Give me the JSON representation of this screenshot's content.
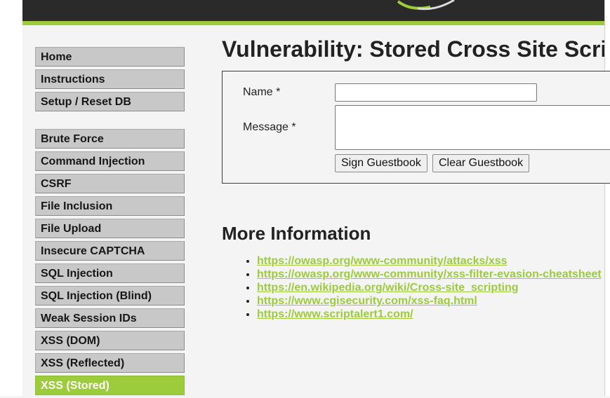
{
  "sidebar": {
    "group1": [
      {
        "label": "Home"
      },
      {
        "label": "Instructions"
      },
      {
        "label": "Setup / Reset DB"
      }
    ],
    "group2": [
      {
        "label": "Brute Force"
      },
      {
        "label": "Command Injection"
      },
      {
        "label": "CSRF"
      },
      {
        "label": "File Inclusion"
      },
      {
        "label": "File Upload"
      },
      {
        "label": "Insecure CAPTCHA"
      },
      {
        "label": "SQL Injection"
      },
      {
        "label": "SQL Injection (Blind)"
      },
      {
        "label": "Weak Session IDs"
      },
      {
        "label": "XSS (DOM)"
      },
      {
        "label": "XSS (Reflected)"
      },
      {
        "label": "XSS (Stored)",
        "active": true
      }
    ]
  },
  "main": {
    "title": "Vulnerability: Stored Cross Site Scripting (XSS)",
    "form": {
      "name_label": "Name *",
      "name_value": "",
      "message_label": "Message *",
      "message_value": "",
      "sign_button": "Sign Guestbook",
      "clear_button": "Clear Guestbook"
    },
    "more_info_title": "More Information",
    "links": [
      "https://owasp.org/www-community/attacks/xss",
      "https://owasp.org/www-community/xss-filter-evasion-cheatsheet",
      "https://en.wikipedia.org/wiki/Cross-site_scripting",
      "https://www.cgisecurity.com/xss-faq.html",
      "https://www.scriptalert1.com/"
    ]
  },
  "colors": {
    "accent": "#9ccb3b",
    "header": "#2a2a2a",
    "menu_bg": "#c8c8c8"
  },
  "icons": {
    "logo": "dvwa-logo-swoosh"
  }
}
